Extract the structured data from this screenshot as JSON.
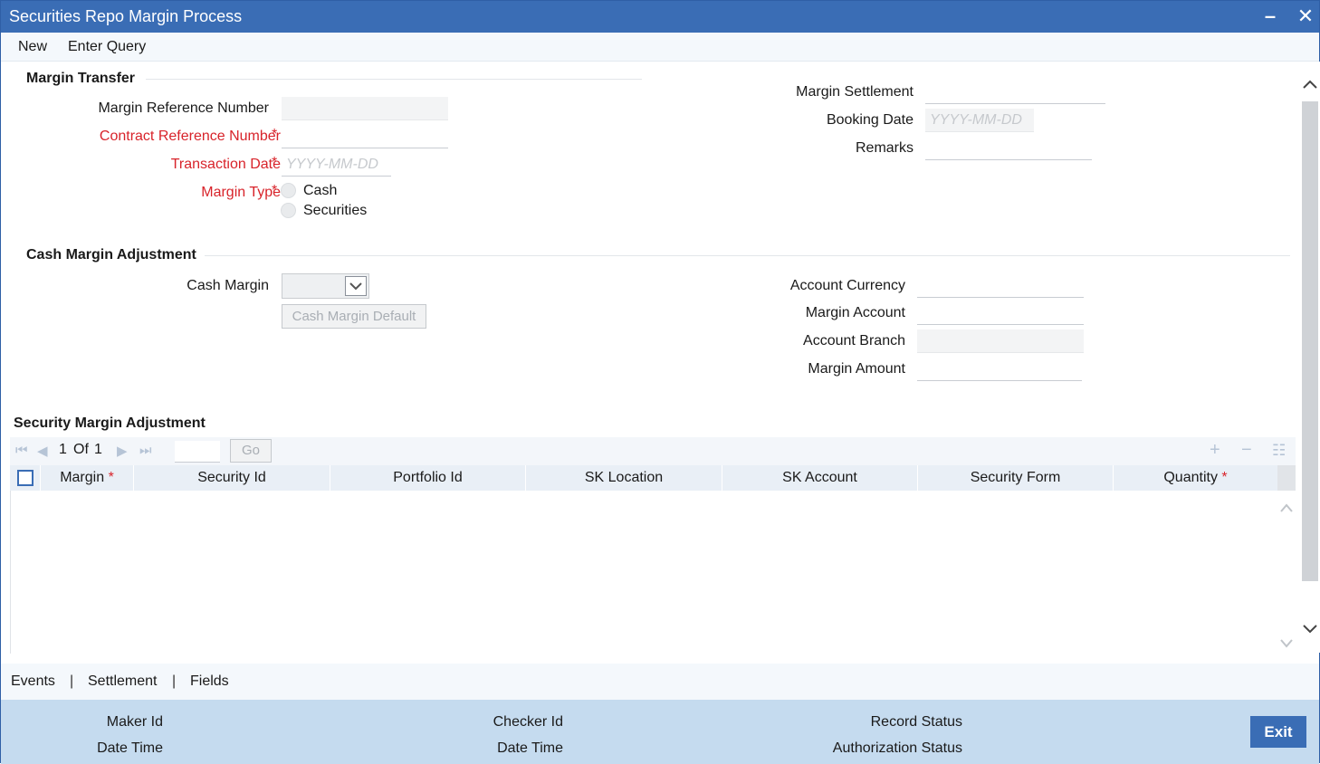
{
  "window": {
    "title": "Securities Repo Margin Process",
    "minimize_glyph": "–",
    "close_glyph": "✕"
  },
  "menu": {
    "new": "New",
    "enter_query": "Enter Query"
  },
  "margin_transfer": {
    "section_title": "Margin Transfer",
    "margin_reference_number": {
      "label": "Margin Reference Number",
      "value": ""
    },
    "contract_reference_number": {
      "label": "Contract Reference Number",
      "value": ""
    },
    "transaction_date": {
      "label": "Transaction Date",
      "placeholder": "YYYY-MM-DD"
    },
    "margin_type": {
      "label": "Margin Type",
      "options": [
        "Cash",
        "Securities"
      ]
    },
    "margin_settlement": {
      "label": "Margin Settlement",
      "value": ""
    },
    "booking_date": {
      "label": "Booking Date",
      "placeholder": "YYYY-MM-DD"
    },
    "remarks": {
      "label": "Remarks",
      "value": ""
    }
  },
  "cash_margin_adjustment": {
    "section_title": "Cash Margin Adjustment",
    "cash_margin": {
      "label": "Cash Margin",
      "value": ""
    },
    "default_button": "Cash Margin Default",
    "account_currency": {
      "label": "Account Currency",
      "value": ""
    },
    "margin_account": {
      "label": "Margin Account",
      "value": ""
    },
    "account_branch": {
      "label": "Account Branch",
      "value": ""
    },
    "margin_amount": {
      "label": "Margin Amount",
      "value": ""
    }
  },
  "security_margin_adjustment": {
    "section_title": "Security Margin Adjustment",
    "pager": {
      "current": "1",
      "of": "Of",
      "total": "1"
    },
    "go_button": "Go",
    "columns": [
      {
        "label": "Margin",
        "required": true
      },
      {
        "label": "Security Id",
        "required": false
      },
      {
        "label": "Portfolio Id",
        "required": false
      },
      {
        "label": "SK Location",
        "required": false
      },
      {
        "label": "SK Account",
        "required": false
      },
      {
        "label": "Security Form",
        "required": false
      },
      {
        "label": "Quantity",
        "required": true
      }
    ],
    "rows": []
  },
  "required_mark": "*",
  "footer_tabs": {
    "events": "Events",
    "separator": "|",
    "settlement": "Settlement",
    "fields": "Fields"
  },
  "footer": {
    "maker_id": "Maker Id",
    "maker_date_time": "Date Time",
    "checker_id": "Checker Id",
    "checker_date_time": "Date Time",
    "record_status": "Record Status",
    "authorization_status": "Authorization Status",
    "exit_button": "Exit"
  },
  "colors": {
    "titlebar": "#3a6db5",
    "required": "#d8232a",
    "footer": "#c5dbef",
    "grid_header": "#e9eff6"
  }
}
